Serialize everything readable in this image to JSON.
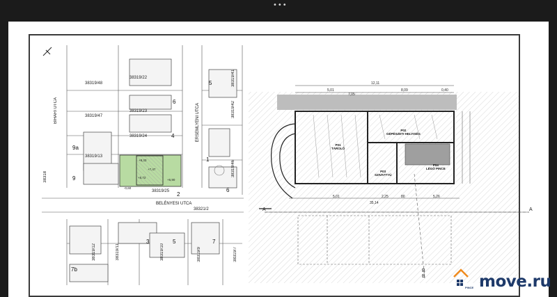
{
  "viewer": {
    "menu_glyph": "•••"
  },
  "brand": {
    "name": "move.ru",
    "sub": "PINCE",
    "icon": "house-logo-icon",
    "accent": "#f08a1c",
    "blue": "#1e3a6a"
  },
  "site_plan": {
    "parcels": [
      "38319/48",
      "38319/22",
      "38319/47",
      "38319/23",
      "38319/24",
      "38319/13",
      "38319/25",
      "38319/41",
      "38319/42",
      "38319/46",
      "38318",
      "38321/2",
      "38319/12",
      "38319/11",
      "38319/10",
      "38319/9",
      "38319/7"
    ],
    "house_numbers": [
      "5",
      "6",
      "4",
      "9a",
      "9",
      "2",
      "1",
      "6",
      "3",
      "5",
      "7",
      "7b"
    ],
    "streets": [
      "BIHARI UTCA",
      "ÉRSEMLYÉNI UTCA",
      "BELÉNYESI UTCA"
    ],
    "plot_marks": [
      "+8,33",
      "+7,47",
      "+5,72",
      "+6,90",
      "-0,60"
    ]
  },
  "floor_plan": {
    "dims": [
      "12,11",
      "5,01",
      "7,05",
      "8,09",
      "0,40",
      "35,14",
      "5,01",
      "2,25",
      "80",
      "5,26"
    ],
    "rooms": [
      {
        "code": "P01",
        "name": "TÁROLÓ"
      },
      {
        "code": "P02",
        "name": "GÉPÉSZETI HELYISÉG"
      },
      {
        "code": "P03",
        "name": "SZIVATTYÚ"
      },
      {
        "code": "P04",
        "name": "LÉGÓ PINCE"
      }
    ],
    "section_marks": [
      "A",
      "A",
      "B",
      "B"
    ]
  }
}
